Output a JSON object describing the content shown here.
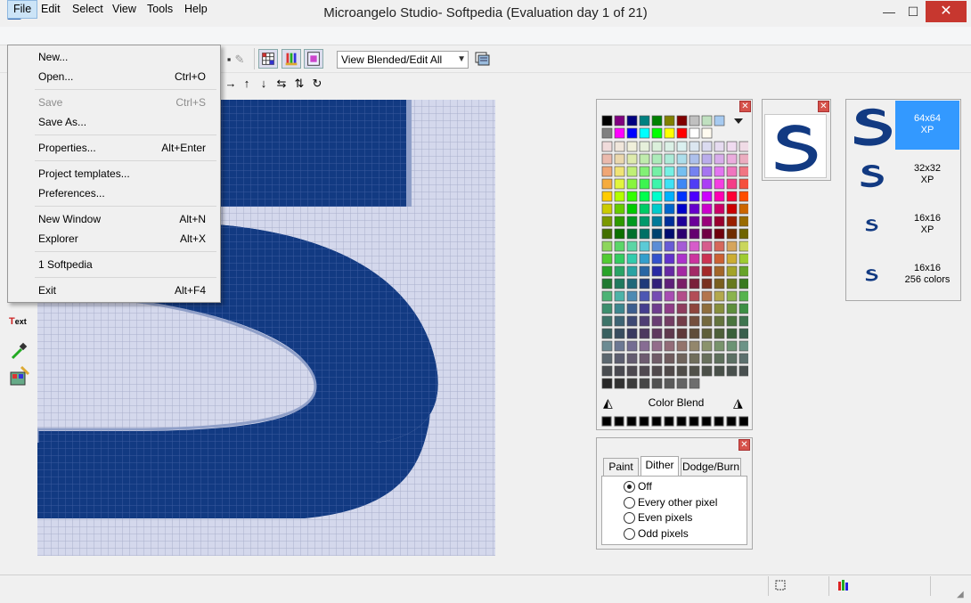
{
  "window": {
    "title": "Microangelo Studio- Softpedia  (Evaluation day 1 of 21)",
    "minimize": "—",
    "maximize": "☐",
    "close": "✕"
  },
  "menubar": {
    "file": "File",
    "edit": "Edit",
    "select": "Select",
    "view": "View",
    "tools": "Tools",
    "help": "Help"
  },
  "toolbar": {
    "view_mode": "View Blended/Edit All"
  },
  "file_menu": {
    "items": [
      {
        "label": "New...",
        "shortcut": "",
        "disabled": false
      },
      {
        "label": "Open...",
        "shortcut": "Ctrl+O",
        "disabled": false
      },
      {
        "label": "Save",
        "shortcut": "Ctrl+S",
        "disabled": true
      },
      {
        "label": "Save As...",
        "shortcut": "",
        "disabled": false
      },
      {
        "label": "Properties...",
        "shortcut": "Alt+Enter",
        "disabled": false
      },
      {
        "label": "Project templates...",
        "shortcut": "",
        "disabled": false
      },
      {
        "label": "Preferences...",
        "shortcut": "",
        "disabled": false
      },
      {
        "label": "New Window",
        "shortcut": "Alt+N",
        "disabled": false
      },
      {
        "label": "Explorer",
        "shortcut": "Alt+X",
        "disabled": false
      },
      {
        "label": "1 Softpedia",
        "shortcut": "",
        "disabled": false
      },
      {
        "label": "Exit",
        "shortcut": "Alt+F4",
        "disabled": false
      }
    ]
  },
  "palette": {
    "top_row": [
      "#000000",
      "#800080",
      "#000080",
      "#008080",
      "#008000",
      "#808000",
      "#800000",
      "#c0c0c0",
      "#c0e0c0",
      "#a6caf0"
    ],
    "second_row": [
      "#808080",
      "#ff00ff",
      "#0000ff",
      "#00ffff",
      "#00ff00",
      "#ffff00",
      "#ff0000",
      "#ffffff",
      "#fffbf0"
    ],
    "color_blend_label": "Color Blend"
  },
  "formats": [
    {
      "size": "64x64",
      "depth": "XP",
      "selected": true
    },
    {
      "size": "32x32",
      "depth": "XP",
      "selected": false
    },
    {
      "size": "16x16",
      "depth": "XP",
      "selected": false
    },
    {
      "size": "16x16",
      "depth": "256 colors",
      "selected": false
    }
  ],
  "dither": {
    "tabs": [
      "Paint",
      "Dither",
      "Dodge/Burn"
    ],
    "active_tab": "Dither",
    "options": [
      {
        "label": "Off",
        "checked": true
      },
      {
        "label": "Every other pixel",
        "checked": false
      },
      {
        "label": "Even pixels",
        "checked": false
      },
      {
        "label": "Odd pixels",
        "checked": false
      }
    ]
  },
  "colors": {
    "icon_blue": "#123a82",
    "grid_light": "#d4d8ec",
    "selection_blue": "#3399ff",
    "close_red": "#c7372f"
  }
}
